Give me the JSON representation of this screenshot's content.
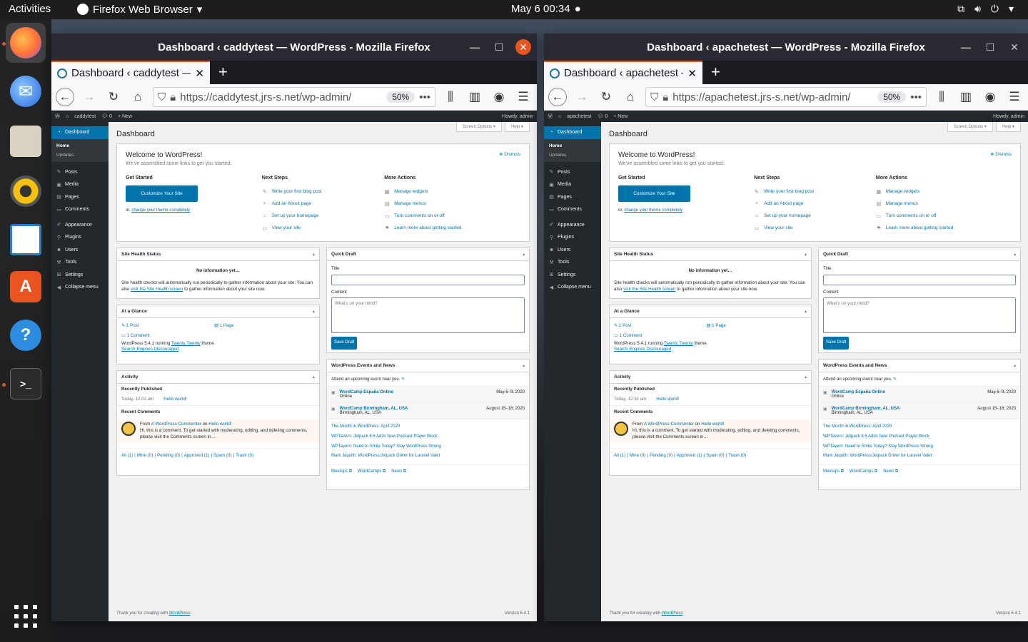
{
  "topbar": {
    "activities": "Activities",
    "app_name": "Firefox Web Browser",
    "clock": "May 6  00:34"
  },
  "dock": {
    "apps": [
      "firefox-icon",
      "thunderbird-icon",
      "files-icon",
      "rhythmbox-icon",
      "libreoffice-writer-icon",
      "ubuntu-software-icon",
      "help-icon",
      "terminal-icon"
    ],
    "grid_label": "show-applications-icon"
  },
  "windows": [
    {
      "title": "Dashboard ‹ caddytest — WordPress - Mozilla Firefox",
      "tab_title": "Dashboard ‹ caddytest — WordPress",
      "url": "https://caddytest.jrs-s.net/wp-admin/",
      "zoom": "50%",
      "site_name": "caddytest",
      "comments_count": "0",
      "new_label": "New",
      "howdy": "Howdy, admin",
      "published_time": "Today, 12:02 am"
    },
    {
      "title": "Dashboard ‹ apachetest — WordPress - Mozilla Firefox",
      "tab_title": "Dashboard ‹ apachetest — WordPress",
      "url": "https://apachetest.jrs-s.net/wp-admin/",
      "zoom": "50%",
      "site_name": "apachetest",
      "comments_count": "0",
      "new_label": "New",
      "howdy": "Howdy, admin",
      "published_time": "Today, 12:34 am"
    }
  ],
  "wp": {
    "menu": {
      "dashboard": "Dashboard",
      "home": "Home",
      "updates": "Updates",
      "posts": "Posts",
      "media": "Media",
      "pages": "Pages",
      "comments": "Comments",
      "appearance": "Appearance",
      "plugins": "Plugins",
      "users": "Users",
      "tools": "Tools",
      "settings": "Settings",
      "collapse": "Collapse menu"
    },
    "screen_options": "Screen Options ▾",
    "help": "Help ▾",
    "page_title": "Dashboard",
    "welcome": {
      "title": "Welcome to WordPress!",
      "subtitle": "We’ve assembled some links to get you started:",
      "dismiss": "Dismiss",
      "get_started": "Get Started",
      "customize": "Customize Your Site",
      "or": "or,",
      "change_theme": "change your theme completely",
      "next_steps": "Next Steps",
      "step1": "Write your first blog post",
      "step2": "Add an About page",
      "step3": "Set up your homepage",
      "step4": "View your site",
      "more_actions": "More Actions",
      "action1": "Manage widgets",
      "action2": "Manage menus",
      "action3": "Turn comments on or off",
      "action4": "Learn more about getting started"
    },
    "site_health": {
      "title": "Site Health Status",
      "no_info": "No information yet…",
      "text1": "Site health checks will automatically run periodically to gather information about your site. You can also",
      "link": "visit the Site Health screen",
      "text2": "to gather information about your site now."
    },
    "glance": {
      "title": "At a Glance",
      "posts": "1 Post",
      "pages": "1 Page",
      "comments": "1 Comment",
      "running_prefix": "WordPress 5.4.1 running",
      "theme": "Twenty Twenty",
      "running_suffix": "theme.",
      "discouraged": "Search Engines Discouraged"
    },
    "activity": {
      "title": "Activity",
      "recently_published": "Recently Published",
      "post": "Hello world!",
      "recent_comments": "Recent Comments",
      "from": "From",
      "commenter": "A WordPress Commenter",
      "on": "on",
      "comment_post": "Hello world!",
      "comment_text": "Hi, this is a comment. To get started with moderating, editing, and deleting comments, please visit the Comments screen in…",
      "filters": [
        "All (1)",
        "Mine (0)",
        "Pending (0)",
        "Approved (1)",
        "Spam (0)",
        "Trash (0)"
      ]
    },
    "quick_draft": {
      "title": "Quick Draft",
      "title_label": "Title",
      "content_label": "Content",
      "content_placeholder": "What’s on your mind?",
      "save": "Save Draft"
    },
    "events": {
      "title": "WordPress Events and News",
      "attend": "Attend an upcoming event near you.",
      "event1_name": "WordCamp España Online",
      "event1_loc": "Online",
      "event1_date": "May 6–9, 2020",
      "event2_name": "WordCamp Birmingham, AL, USA",
      "event2_loc": "Birmingham, AL, USA",
      "event2_date": "August 15–16, 2020",
      "news": [
        "The Month in WordPress: April 2020",
        "WPTavern: Jetpack 8.5 Adds New Podcast Player Block",
        "WPTavern: Need to Smile Today? Stay WordPress Strong",
        "Mark Jaquith: WordPress/Jetpack Driver for Laravel Valet"
      ],
      "meetups": "Meetups",
      "wordcamps": "WordCamps",
      "news_link": "News"
    },
    "footer_thanks": "Thank you for creating with",
    "footer_wp": "WordPress",
    "version": "Version 5.4.1"
  }
}
